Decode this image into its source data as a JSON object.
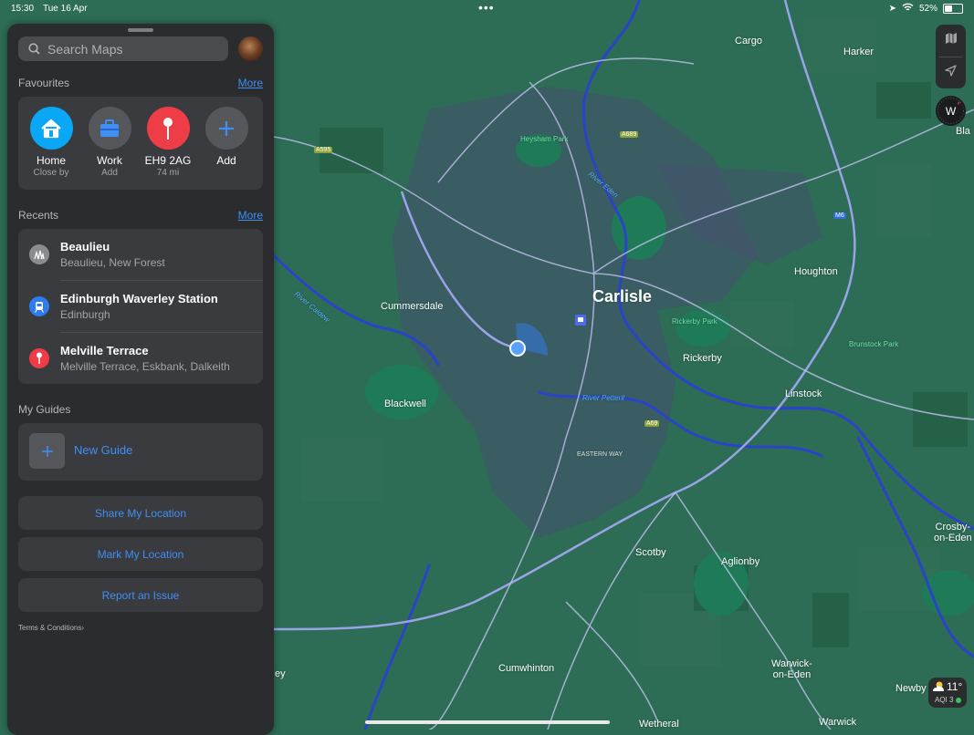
{
  "status": {
    "time": "15:30",
    "date": "Tue 16 Apr",
    "battery": "52%",
    "battery_level": 0.52
  },
  "search": {
    "placeholder": "Search Maps"
  },
  "favourites": {
    "title": "Favourites",
    "more": "More",
    "items": [
      {
        "label": "Home",
        "sub": "Close by",
        "icon": "house-icon",
        "color": "#0aa7f5"
      },
      {
        "label": "Work",
        "sub": "Add",
        "icon": "briefcase-icon",
        "color": "#56575b"
      },
      {
        "label": "EH9 2AG",
        "sub": "74 mi",
        "icon": "pin-icon",
        "color": "#ef3d48"
      },
      {
        "label": "Add",
        "sub": "",
        "icon": "plus-icon",
        "color": "#56575b"
      }
    ]
  },
  "recents": {
    "title": "Recents",
    "more": "More",
    "items": [
      {
        "title": "Beaulieu",
        "sub": "Beaulieu, New Forest",
        "icon": "landmark-icon",
        "color": "#8b8c90"
      },
      {
        "title": "Edinburgh Waverley Station",
        "sub": "Edinburgh",
        "icon": "train-icon",
        "color": "#2f7bf0"
      },
      {
        "title": "Melville Terrace",
        "sub": "Melville Terrace, Eskbank, Dalkeith",
        "icon": "pin-icon",
        "color": "#ef3d48"
      }
    ]
  },
  "guides": {
    "title": "My Guides",
    "new_guide": "New Guide"
  },
  "actions": {
    "share": "Share My Location",
    "mark": "Mark My Location",
    "report": "Report an Issue"
  },
  "terms": "Terms & Conditions",
  "compass": "W",
  "weather": {
    "temp": "11°",
    "aqi": "AQI 3"
  },
  "map_labels": {
    "carlisle": "Carlisle",
    "cargo": "Cargo",
    "harker": "Harker",
    "houghton": "Houghton",
    "cummersdale": "Cummersdale",
    "rickerby": "Rickerby",
    "linstock": "Linstock",
    "blackwell": "Blackwell",
    "scotby": "Scotby",
    "aglionby": "Aglionby",
    "crosby": "Crosby-\non-Eden",
    "cumwhinton": "Cumwhinton",
    "warwick_on_eden": "Warwick-\non-Eden",
    "newby": "Newby",
    "wetheral": "Wetheral",
    "warwick": "Warwick",
    "bla": "Bla",
    "ey": "ey",
    "heysham_park": "Heysham Park",
    "rickerby_park": "Rickerby Park",
    "brunstock_park": "Brunstock Park",
    "river_eden": "River Eden",
    "river_petteril": "River Petteril",
    "river_caldew": "River Caldew",
    "eastern_way": "EASTERN WAY",
    "a595": "A595",
    "a689": "A689",
    "a69": "A69",
    "m6": "M6"
  }
}
